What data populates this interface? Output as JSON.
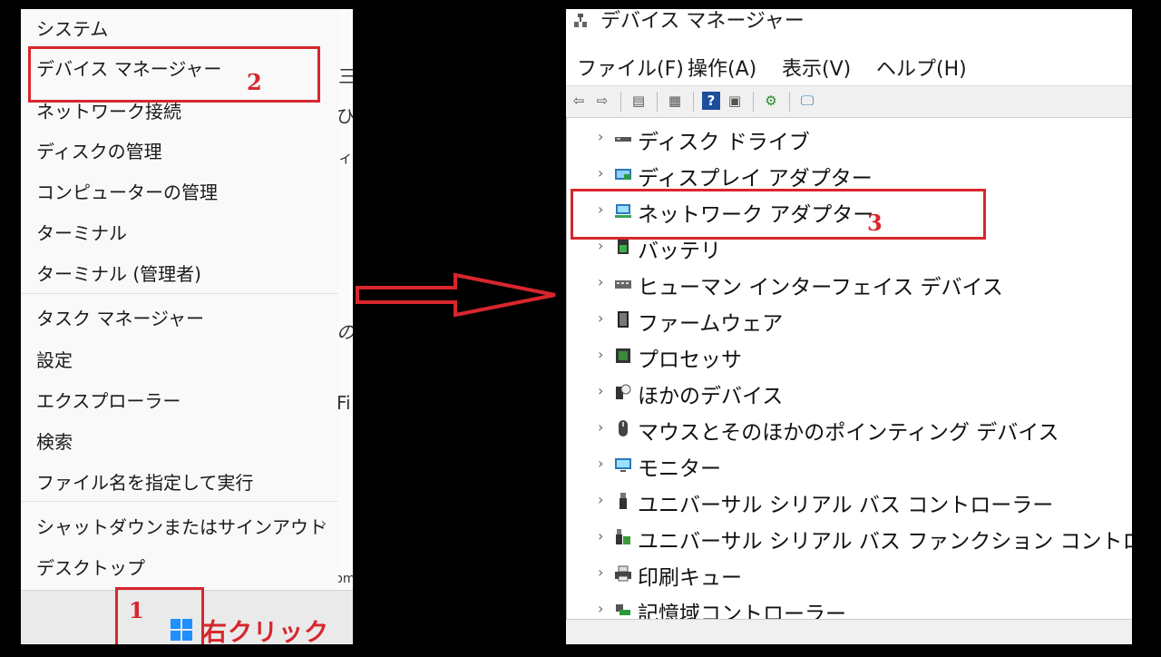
{
  "context_menu": {
    "items": [
      {
        "label": "システム"
      },
      {
        "label": "デバイス マネージャー"
      },
      {
        "label": "ネットワーク接続"
      },
      {
        "label": "ディスクの管理"
      },
      {
        "label": "コンピューターの管理"
      },
      {
        "label": "ターミナル"
      },
      {
        "label": "ターミナル (管理者)"
      },
      {
        "label": "タスク マネージャー"
      },
      {
        "label": "設定"
      },
      {
        "label": "エクスプローラー"
      },
      {
        "label": "検索"
      },
      {
        "label": "ファイル名を指定して実行"
      },
      {
        "label": "シャットダウンまたはサインアウト"
      },
      {
        "label": "デスクトップ"
      }
    ],
    "submenu_chevron": "›"
  },
  "background_fragments": [
    "三",
    "ひ",
    "ィ",
    "の",
    "Fi",
    "pm"
  ],
  "taskbar": {
    "start_icon": "windows-logo-icon"
  },
  "annotations": {
    "step1": "1",
    "step2": "2",
    "step3": "3",
    "right_click": "右クリック",
    "arrow_color": "#d8262d"
  },
  "device_manager": {
    "title": "デバイス マネージャー",
    "menu": [
      "ファイル(F)",
      "操作(A)",
      "表示(V)",
      "ヘルプ(H)"
    ],
    "toolbar": [
      "back-icon",
      "forward-icon",
      "properties-grid-icon",
      "console-tree-icon",
      "help-icon",
      "action-pane-icon",
      "update-driver-icon",
      "scan-hardware-icon"
    ],
    "nodes": [
      {
        "label": "ディスク ドライブ",
        "icon": "disk-drive-icon"
      },
      {
        "label": "ディスプレイ アダプター",
        "icon": "display-adapter-icon"
      },
      {
        "label": "ネットワーク アダプター",
        "icon": "network-adapter-icon"
      },
      {
        "label": "バッテリ",
        "icon": "battery-icon"
      },
      {
        "label": "ヒューマン インターフェイス デバイス",
        "icon": "hid-icon"
      },
      {
        "label": "ファームウェア",
        "icon": "firmware-icon"
      },
      {
        "label": "プロセッサ",
        "icon": "processor-icon"
      },
      {
        "label": "ほかのデバイス",
        "icon": "other-devices-icon"
      },
      {
        "label": "マウスとそのほかのポインティング デバイス",
        "icon": "mouse-icon"
      },
      {
        "label": "モニター",
        "icon": "monitor-icon"
      },
      {
        "label": "ユニバーサル シリアル バス コントローラー",
        "icon": "usb-controller-icon"
      },
      {
        "label": "ユニバーサル シリアル バス ファンクション コントローラー",
        "icon": "usb-function-icon"
      },
      {
        "label": "印刷キュー",
        "icon": "print-queue-icon"
      },
      {
        "label": "記憶域コントローラー",
        "icon": "storage-controller-icon"
      }
    ],
    "expander": "›"
  },
  "colors": {
    "highlight": "#d8262d",
    "win_blue": "#1e90ff"
  }
}
